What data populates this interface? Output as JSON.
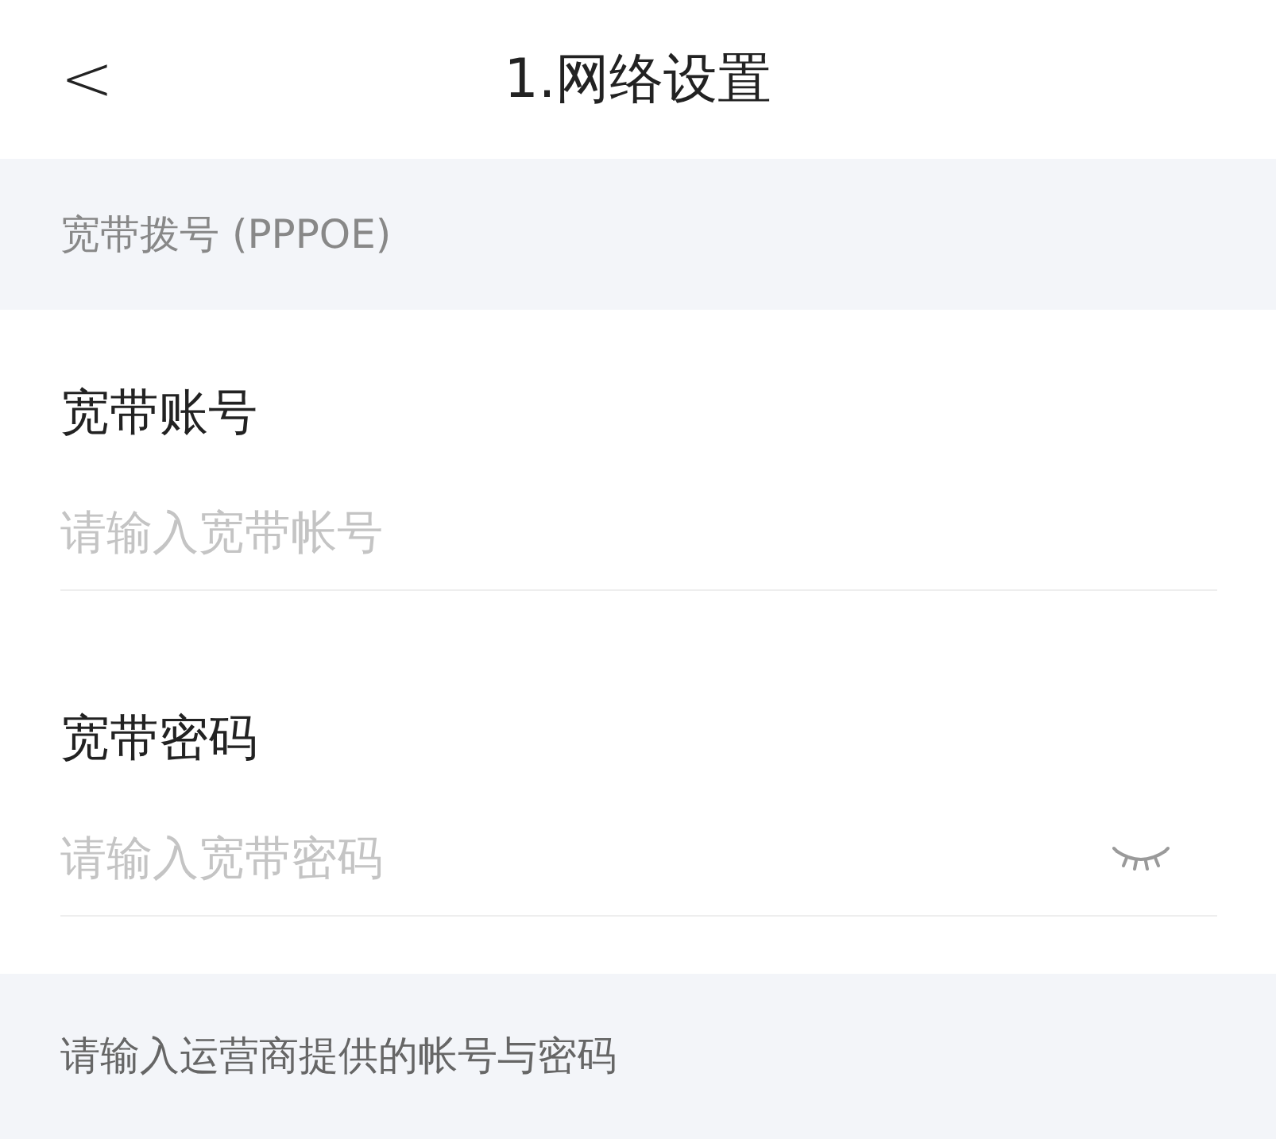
{
  "header": {
    "back": "<",
    "title": "1.网络设置"
  },
  "section": {
    "title": "宽带拨号 (PPPOE)"
  },
  "fields": [
    {
      "label": "宽带账号",
      "placeholder": "请输入宽带帐号",
      "kind": "text"
    },
    {
      "label": "宽带密码",
      "placeholder": "请输入宽带密码",
      "kind": "password"
    }
  ],
  "note": "请输入运营商提供的帐号与密码"
}
